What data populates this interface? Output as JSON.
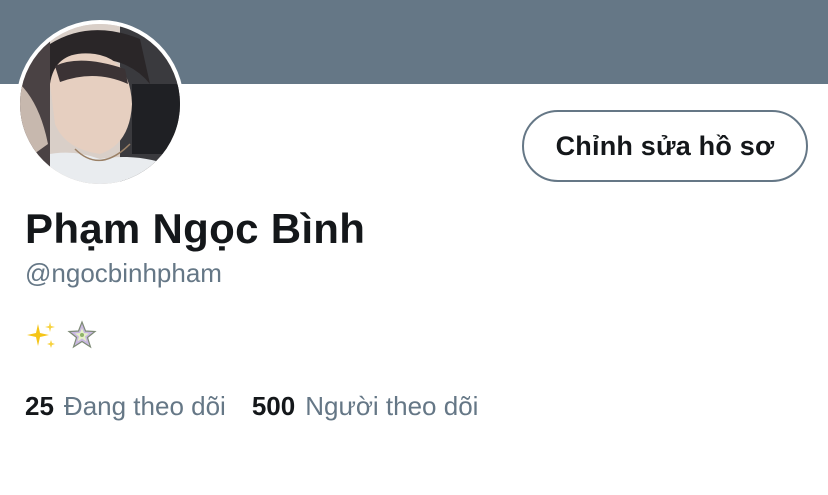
{
  "profile": {
    "display_name": "Phạm Ngọc Bình",
    "handle": "@ngocbinhpham",
    "edit_button_label": "Chỉnh sửa hồ sơ",
    "bio_icons": [
      "sparkles-icon",
      "star-ornament-icon"
    ],
    "stats": {
      "following_count": "25",
      "following_label": "Đang theo dõi",
      "followers_count": "500",
      "followers_label": "Người theo dõi"
    }
  },
  "colors": {
    "banner": "#657786",
    "text_primary": "#14171a",
    "text_secondary": "#657786",
    "button_border": "#657786"
  }
}
